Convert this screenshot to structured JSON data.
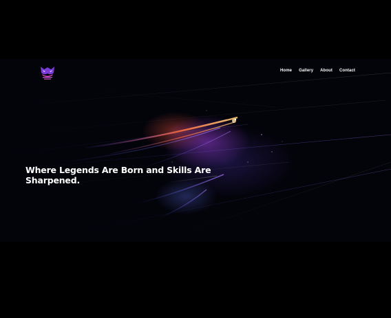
{
  "brand": {
    "logo_icon": "mask-emblem-icon",
    "logo_text": "",
    "colors": {
      "logo_primary": "#7a3bd6",
      "logo_accent": "#d94ab8"
    }
  },
  "nav": {
    "items": [
      {
        "label": "Home"
      },
      {
        "label": "Gallery"
      },
      {
        "label": "About"
      },
      {
        "label": "Contact"
      }
    ]
  },
  "hero": {
    "heading": "Where Legends Are Born and Skills Are Sharpened.",
    "background_icon": "light-streaks-background"
  },
  "colors": {
    "page_background": "#000000",
    "text": "#ffffff"
  }
}
